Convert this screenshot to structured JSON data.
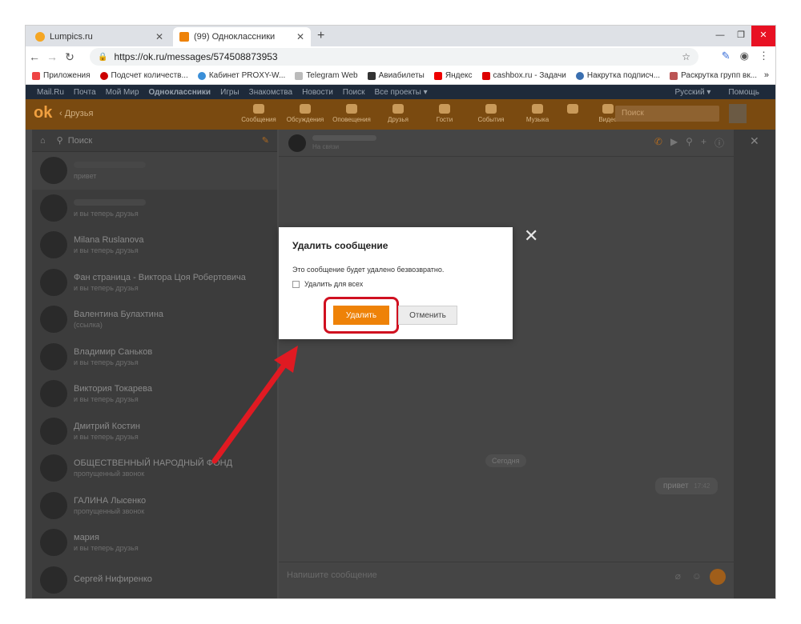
{
  "browser": {
    "tabs": [
      {
        "title": "Lumpics.ru",
        "favicon_color": "#f5a623"
      },
      {
        "title": "(99) Одноклассники",
        "favicon_color": "#ee8208"
      }
    ],
    "url": "https://ok.ru/messages/574508873953",
    "bookmarks": [
      {
        "label": "Приложения",
        "icon": "apps-grid-icon",
        "color": "#e44"
      },
      {
        "label": "Подсчет количеств...",
        "icon": "copyright-icon",
        "color": "#c00"
      },
      {
        "label": "Кабинет PROXY-W...",
        "icon": "cloud-icon",
        "color": "#3a8fd8"
      },
      {
        "label": "Telegram Web",
        "icon": "page-icon",
        "color": "#999"
      },
      {
        "label": "Авиабилеты",
        "icon": "plane-icon",
        "color": "#333"
      },
      {
        "label": "Яндекс",
        "icon": "yandex-icon",
        "color": "#e00"
      },
      {
        "label": "cashbox.ru - Задачи",
        "icon": "play-icon",
        "color": "#d00"
      },
      {
        "label": "Накрутка подписч...",
        "icon": "globe-icon",
        "color": "#3a6fb0"
      },
      {
        "label": "Раскрутка групп вк...",
        "icon": "v-icon",
        "color": "#b55"
      }
    ],
    "bookmarks_more": "»"
  },
  "portal": {
    "links": [
      "Mail.Ru",
      "Почта",
      "Мой Мир",
      "Одноклассники",
      "Игры",
      "Знакомства",
      "Новости",
      "Поиск",
      "Все проекты ▾"
    ],
    "language": "Русский ▾",
    "help": "Помощь"
  },
  "okbar": {
    "friends": "Друзья",
    "nav": [
      "Сообщения",
      "Обсуждения",
      "Оповещения",
      "Друзья",
      "Гости",
      "События",
      "Музыка",
      "",
      "Видео"
    ],
    "search_placeholder": "Поиск"
  },
  "sidebar": {
    "search_placeholder": "Поиск",
    "contacts": [
      {
        "name": "",
        "sub": "привет"
      },
      {
        "name": "",
        "sub": "и вы теперь друзья"
      },
      {
        "name": "Milana Ruslanova",
        "sub": "и вы теперь друзья"
      },
      {
        "name": "Фан страница - Виктора Цоя Робертовича",
        "sub": "и вы теперь друзья"
      },
      {
        "name": "Валентина Булахтина",
        "sub": "(ссылка)"
      },
      {
        "name": "Владимир Саньков",
        "sub": "и вы теперь друзья"
      },
      {
        "name": "Виктория Токарева",
        "sub": "и вы теперь друзья"
      },
      {
        "name": "Дмитрий Костин",
        "sub": "и вы теперь друзья"
      },
      {
        "name": "ОБЩЕСТВЕННЫЙ НАРОДНЫЙ ФОНД",
        "sub": "пропущенный звонок"
      },
      {
        "name": "ГАЛИНА Лысенко",
        "sub": "пропущенный звонок"
      },
      {
        "name": "мария",
        "sub": "и вы теперь друзья"
      },
      {
        "name": "Сергей Нифиренко",
        "sub": ""
      }
    ]
  },
  "chat": {
    "status": "На связи",
    "today": "Сегодня",
    "message": "привет",
    "message_time": "17:42",
    "compose_placeholder": "Напишите сообщение"
  },
  "modal": {
    "title": "Удалить сообщение",
    "description": "Это сообщение будет удалено безвозвратно.",
    "checkbox_label": "Удалить для всех",
    "delete_label": "Удалить",
    "cancel_label": "Отменить",
    "close_glyph": "✕"
  },
  "colors": {
    "accent": "#ee8208",
    "highlight": "#d01020"
  }
}
